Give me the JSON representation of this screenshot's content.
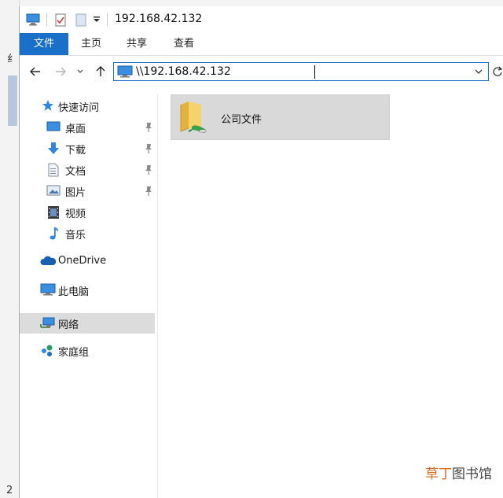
{
  "window": {
    "title": "192.168.42.132",
    "accent": "#1a6fc9"
  },
  "ribbon": {
    "tabs": [
      {
        "label": "文件"
      },
      {
        "label": "主页"
      },
      {
        "label": "共享"
      },
      {
        "label": "查看"
      }
    ]
  },
  "address": {
    "value": "\\\\192.168.42.132"
  },
  "nav_pane": {
    "quick_access": {
      "label": "快速访问",
      "icon": "star-icon"
    },
    "quick_items": [
      {
        "label": "桌面",
        "icon": "desktop-icon",
        "pinned": true
      },
      {
        "label": "下载",
        "icon": "download-arrow-icon",
        "pinned": true
      },
      {
        "label": "文档",
        "icon": "document-icon",
        "pinned": true
      },
      {
        "label": "图片",
        "icon": "pictures-icon",
        "pinned": true
      },
      {
        "label": "视频",
        "icon": "video-icon",
        "pinned": false
      },
      {
        "label": "音乐",
        "icon": "music-note-icon",
        "pinned": false
      }
    ],
    "onedrive": {
      "label": "OneDrive",
      "icon": "cloud-icon"
    },
    "this_pc": {
      "label": "此电脑",
      "icon": "computer-icon"
    },
    "network": {
      "label": "网络",
      "icon": "network-icon",
      "selected": true
    },
    "homegroup": {
      "label": "家庭组",
      "icon": "homegroup-icon"
    }
  },
  "content": {
    "items": [
      {
        "label": "公司文件",
        "icon": "shared-folder-icon"
      }
    ]
  },
  "background": {
    "left_char_top": "纟",
    "left_char_bottom": "2"
  },
  "watermark": {
    "accent_text": "草丁",
    "rest_text": "图书馆"
  }
}
